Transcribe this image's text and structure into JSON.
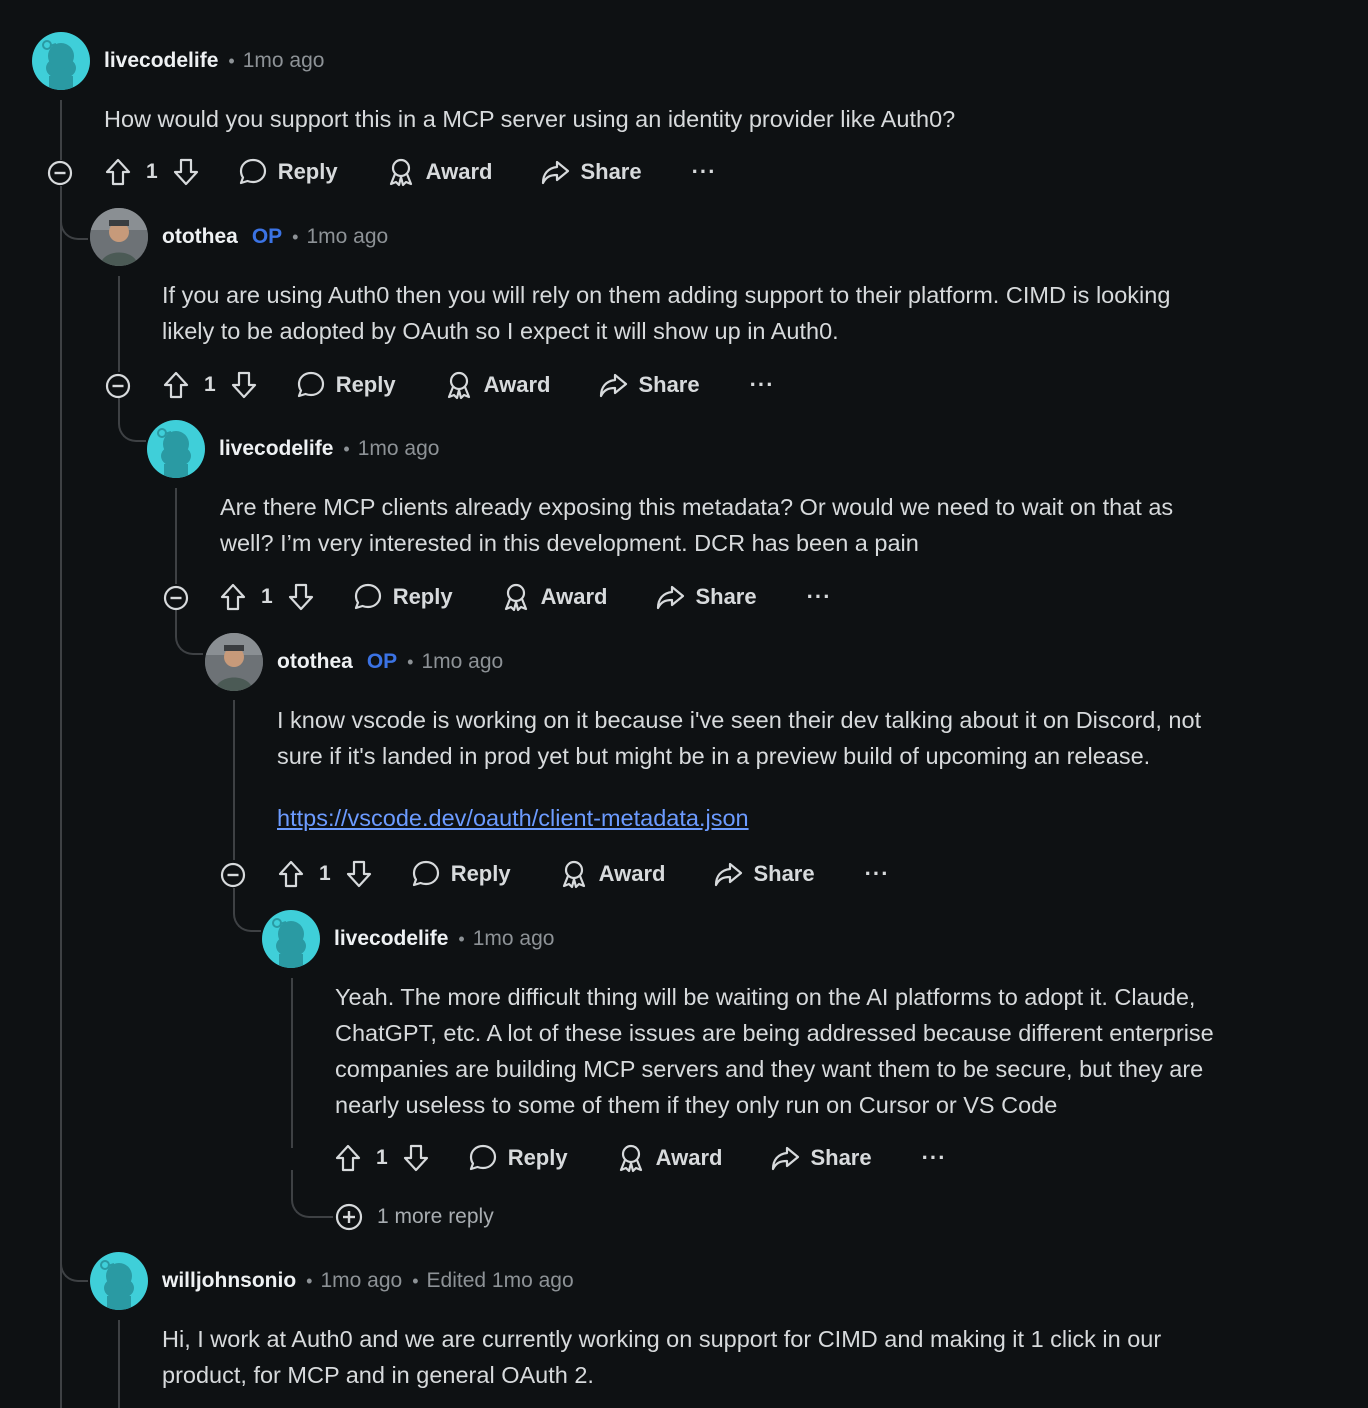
{
  "comments": [
    {
      "username": "livecodelife",
      "op_badge": "",
      "time": "1mo ago",
      "edited": "",
      "body_lines": [
        "How would you support this in a MCP server using an identity provider like Auth0?"
      ],
      "votes": "1",
      "avatar": "snoo"
    },
    {
      "username": "otothea",
      "op_badge": "OP",
      "time": "1mo ago",
      "edited": "",
      "body_lines": [
        "If you are using Auth0 then you will rely on them adding support to their platform. CIMD is looking",
        "likely to be adopted by OAuth so I expect it will show up in Auth0."
      ],
      "votes": "1",
      "avatar": "photo"
    },
    {
      "username": "livecodelife",
      "op_badge": "",
      "time": "1mo ago",
      "edited": "",
      "body_lines": [
        "Are there MCP clients already exposing this metadata? Or would we need to wait on that as",
        "well? I’m very interested in this development. DCR has been a pain"
      ],
      "votes": "1",
      "avatar": "snoo"
    },
    {
      "username": "otothea",
      "op_badge": "OP",
      "time": "1mo ago",
      "edited": "",
      "body_lines": [
        "I know vscode is working on it because i've seen their dev talking about it on Discord, not",
        "sure if it's landed in prod yet but might be in a preview build of upcoming an release."
      ],
      "link": "https://vscode.dev/oauth/client-metadata.json",
      "votes": "1",
      "avatar": "photo"
    },
    {
      "username": "livecodelife",
      "op_badge": "",
      "time": "1mo ago",
      "edited": "",
      "body_lines": [
        "Yeah. The more difficult thing will be waiting on the AI platforms to adopt it. Claude,",
        "ChatGPT, etc. A lot of these issues are being addressed because different enterprise",
        "companies are building MCP servers and they want them to be secure, but they are",
        "nearly useless to some of them if they only run on Cursor or VS Code"
      ],
      "votes": "1",
      "avatar": "snoo",
      "more_replies": "1 more reply"
    },
    {
      "username": "willjohnsonio",
      "op_badge": "",
      "time": "1mo ago",
      "edited": "Edited 1mo ago",
      "body_lines": [
        "Hi, I work at Auth0 and we are currently working on support for CIMD and making it 1 click in our",
        "product, for MCP and in general OAuth 2."
      ],
      "avatar": "snoo"
    }
  ],
  "actions": {
    "reply": "Reply",
    "award": "Award",
    "share": "Share",
    "more": "···"
  },
  "icons": {
    "upvote": "arrow-up-icon",
    "downvote": "arrow-down-icon",
    "reply": "speech-bubble-icon",
    "award": "award-ribbon-icon",
    "share": "share-arrow-icon",
    "collapse": "minus-circle-icon",
    "expand": "plus-circle-icon"
  },
  "colors": {
    "background": "#0e1113",
    "avatar_snoo": "#3fcfd9",
    "op_badge": "#3b73e4",
    "link": "#6c9bff"
  }
}
